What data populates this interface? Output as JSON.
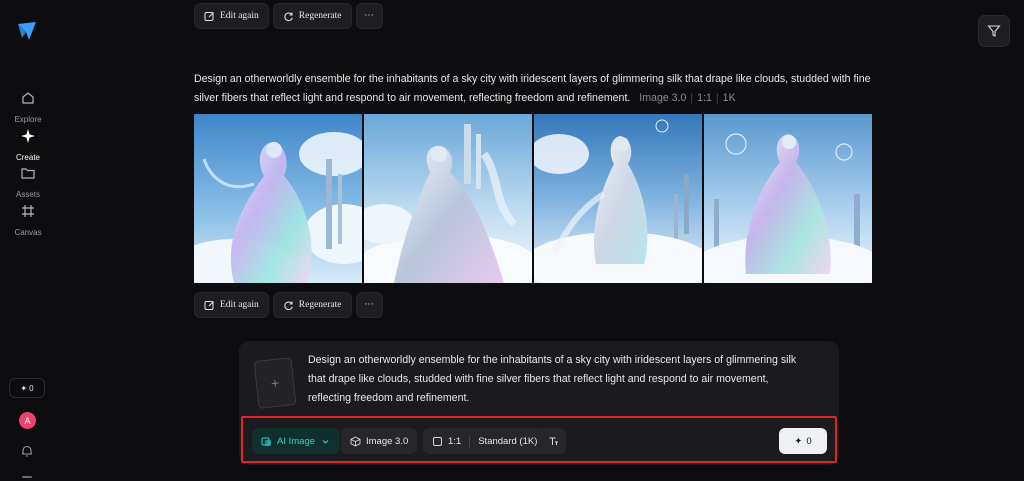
{
  "sidebar": {
    "logo_icon": "logo-star-icon",
    "items": [
      {
        "label": "Explore",
        "icon": "home-icon"
      },
      {
        "label": "Create",
        "icon": "sparkle-icon"
      },
      {
        "label": "Assets",
        "icon": "folder-icon"
      },
      {
        "label": "Canvas",
        "icon": "grid-icon"
      }
    ],
    "credits": "0",
    "avatar_initial": "A"
  },
  "actions": {
    "edit_again": "Edit again",
    "regenerate": "Regenerate",
    "more": "···"
  },
  "generation": {
    "prompt": "Design an otherworldly ensemble for the inhabitants of a sky city with iridescent layers of glimmering silk that drape like clouds, studded with fine silver fibers that reflect light and respond to air movement, reflecting freedom and refinement.",
    "model": "Image 3.0",
    "ratio": "1:1",
    "resolution": "1K",
    "image_count": 4
  },
  "composer": {
    "prompt": "Design an otherworldly ensemble for the inhabitants of a sky city with iridescent layers of glimmering silk that drape like clouds, studded with fine silver fibers that reflect light and respond to air movement, reflecting freedom and refinement.",
    "upload_symbol": "+",
    "mode": "AI Image",
    "model": "Image 3.0",
    "ratio": "1:1",
    "quality": "Standard (1K)",
    "generate_cost": "0"
  },
  "colors": {
    "accent": "#2fd3c7",
    "highlight_box": "#e0242c",
    "avatar": "#e8436d"
  }
}
